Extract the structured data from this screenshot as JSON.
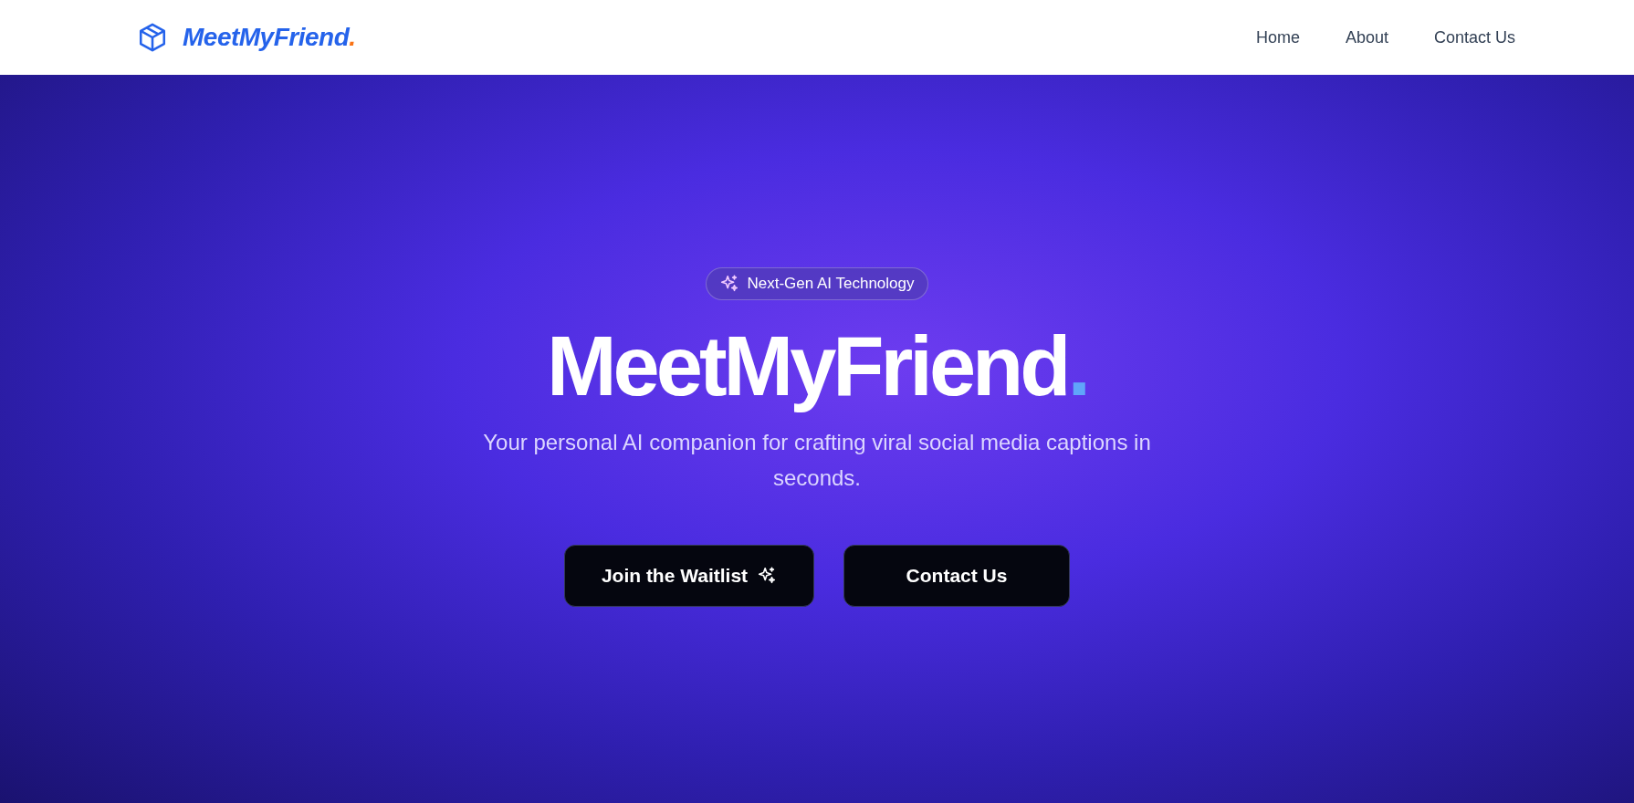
{
  "header": {
    "brand": "MeetMyFriend",
    "brand_dot": ".",
    "nav": [
      {
        "label": "Home"
      },
      {
        "label": "About"
      },
      {
        "label": "Contact Us"
      }
    ]
  },
  "hero": {
    "badge": "Next-Gen AI Technology",
    "title": "MeetMyFriend",
    "title_dot": ".",
    "subtitle": "Your personal AI companion for crafting viral social media captions in seconds.",
    "buttons": [
      {
        "label": "Join the Waitlist",
        "kind": "sparkle"
      },
      {
        "label": "Contact Us",
        "kind": "plain"
      }
    ]
  }
}
